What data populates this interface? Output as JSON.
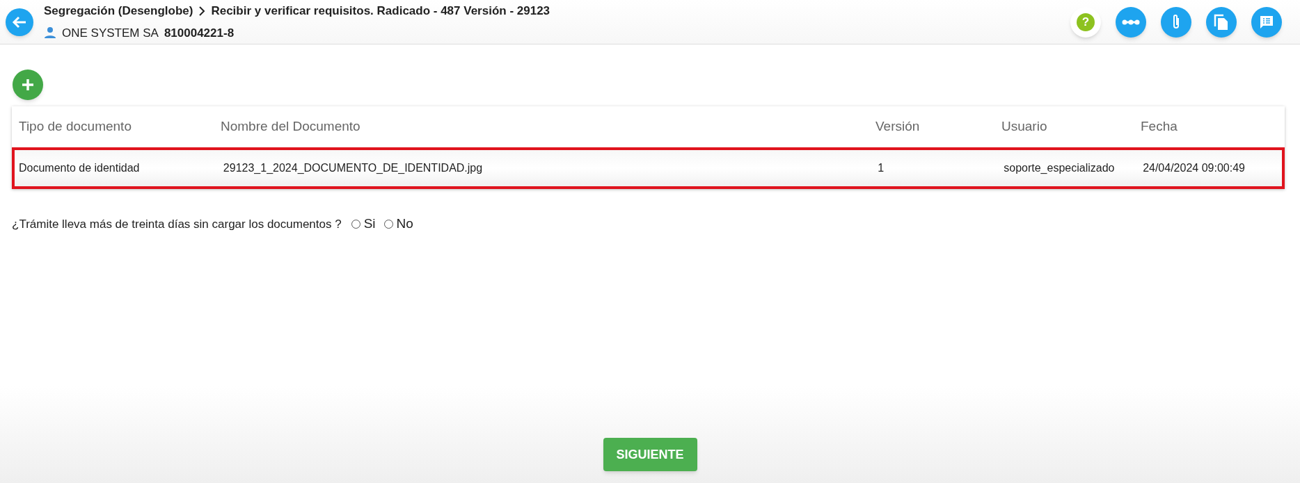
{
  "header": {
    "breadcrumb": [
      "Segregación (Desenglobe)",
      "Recibir y verificar requisitos. Radicado - 487 Versión - 29123"
    ],
    "company": "ONE SYSTEM SA",
    "company_id": "810004221-8",
    "actions": [
      {
        "kind": "help",
        "label": "?"
      },
      {
        "kind": "flow"
      },
      {
        "kind": "attach"
      },
      {
        "kind": "copy"
      },
      {
        "kind": "comments"
      }
    ]
  },
  "table": {
    "columns": [
      "Tipo de documento",
      "Nombre del Documento",
      "Versión",
      "Usuario",
      "Fecha"
    ],
    "rows": [
      {
        "cells": [
          "Documento de identidad",
          "29123_1_2024_DOCUMENTO_DE_IDENTIDAD.jpg",
          "1",
          "soporte_especializado",
          "24/04/2024 09:00:49"
        ],
        "highlighted": true
      }
    ]
  },
  "question": {
    "text": "¿Trámite lleva más de treinta días sin cargar los documentos ?",
    "options": [
      {
        "label": "Si",
        "selected": false
      },
      {
        "label": "No",
        "selected": false
      }
    ]
  },
  "next_button": "SIGUIENTE"
}
